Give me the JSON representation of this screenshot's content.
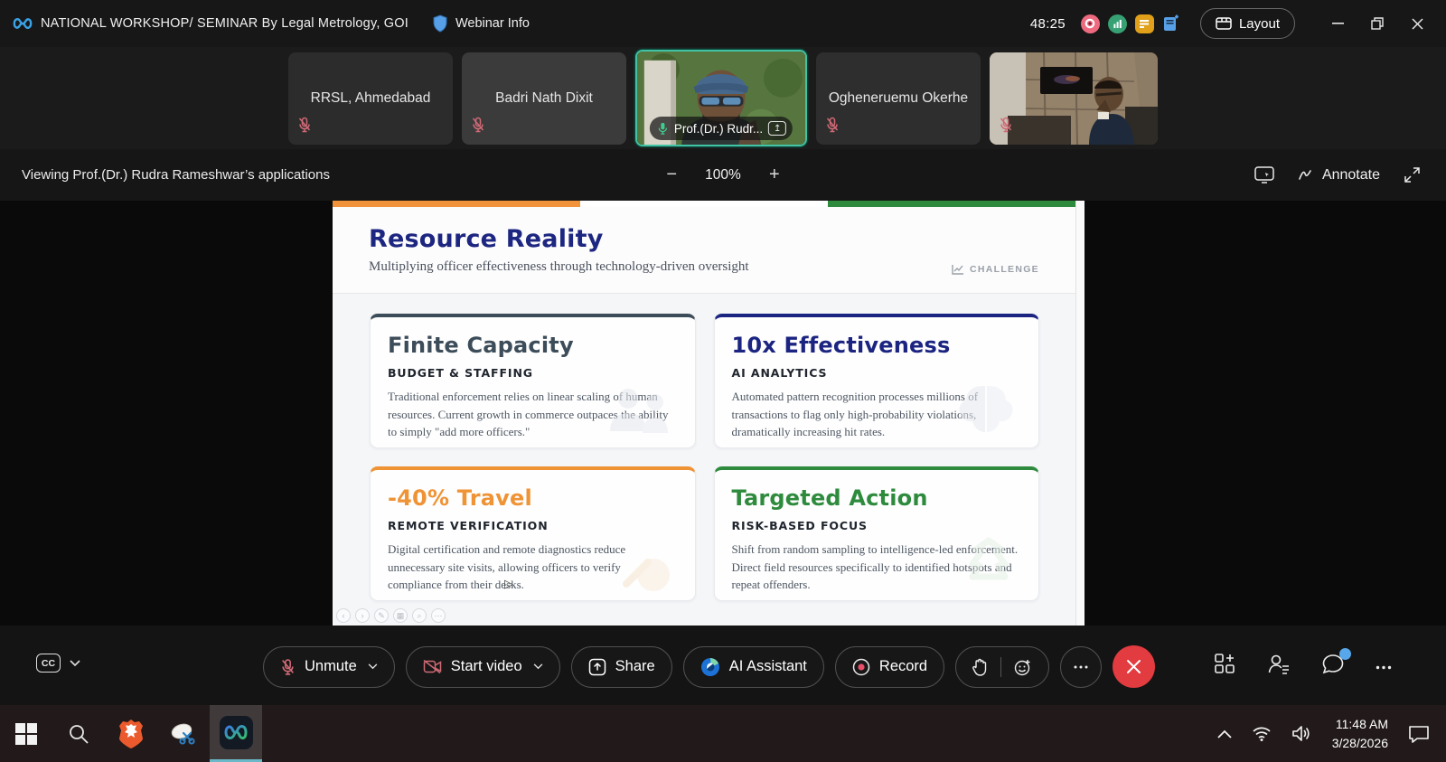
{
  "meeting": {
    "app_title": "NATIONAL WORKSHOP/ SEMINAR By Legal Metrology, GOI",
    "webinar_info_label": "Webinar Info",
    "timer": "48:25",
    "layout_label": "Layout"
  },
  "video_tiles": [
    {
      "name": "RRSL, Ahmedabad",
      "muted": true
    },
    {
      "name": "Badri Nath  Dixit",
      "muted": true
    },
    {
      "name": "Prof.(Dr.) Rudr...",
      "muted": false,
      "active": true,
      "sharing": true
    },
    {
      "name": "Ogheneruemu Okerhe",
      "muted": true
    },
    {
      "name": "",
      "muted": true
    }
  ],
  "viewing_bar": {
    "text": "Viewing Prof.(Dr.) Rudra Rameshwar’s applications",
    "zoom_out": "−",
    "zoom_level": "100%",
    "zoom_in": "+",
    "annotate_label": "Annotate"
  },
  "slide": {
    "title": "Resource Reality",
    "subtitle": "Multiplying officer effectiveness through technology-driven oversight",
    "badge": "CHALLENGE",
    "flag_colors": {
      "saffron": "#F0933A",
      "white": "#FFFFFF",
      "green": "#2E8B3D"
    },
    "cards": [
      {
        "title": "Finite Capacity",
        "subtitle": "BUDGET & STAFFING",
        "body": "Traditional enforcement relies on linear scaling of human resources. Current growth in commerce outpaces the ability to simply \"add more officers.\"",
        "color": "#3C4C59"
      },
      {
        "title": "10x Effectiveness",
        "subtitle": "AI ANALYTICS",
        "body": "Automated pattern recognition processes millions of transactions to flag only high-probability violations, dramatically increasing hit rates.",
        "color": "#1B2480"
      },
      {
        "title": "-40% Travel",
        "subtitle": "REMOTE VERIFICATION",
        "body": "Digital certification and remote diagnostics reduce unnecessary site visits, allowing officers to verify compliance from their desks.",
        "color": "#EF9335"
      },
      {
        "title": "Targeted Action",
        "subtitle": "RISK-BASED FOCUS",
        "body": "Shift from random sampling to intelligence-led enforcement. Direct field resources specifically to identified hotspots and repeat offenders.",
        "color": "#2E8B3D"
      }
    ]
  },
  "controls": {
    "cc_label": "CC",
    "unmute_label": "Unmute",
    "start_video_label": "Start video",
    "share_label": "Share",
    "ai_assistant_label": "AI Assistant",
    "record_label": "Record"
  },
  "taskbar": {
    "time": "11:48 AM",
    "date": "3/28/2026"
  },
  "colors": {
    "accent_teal": "#42C3A4",
    "mic_muted_red": "#D06A76",
    "mic_on_green": "#3ECF8E",
    "leave_red": "#E23B40",
    "notification_blue": "#57A7EA"
  }
}
